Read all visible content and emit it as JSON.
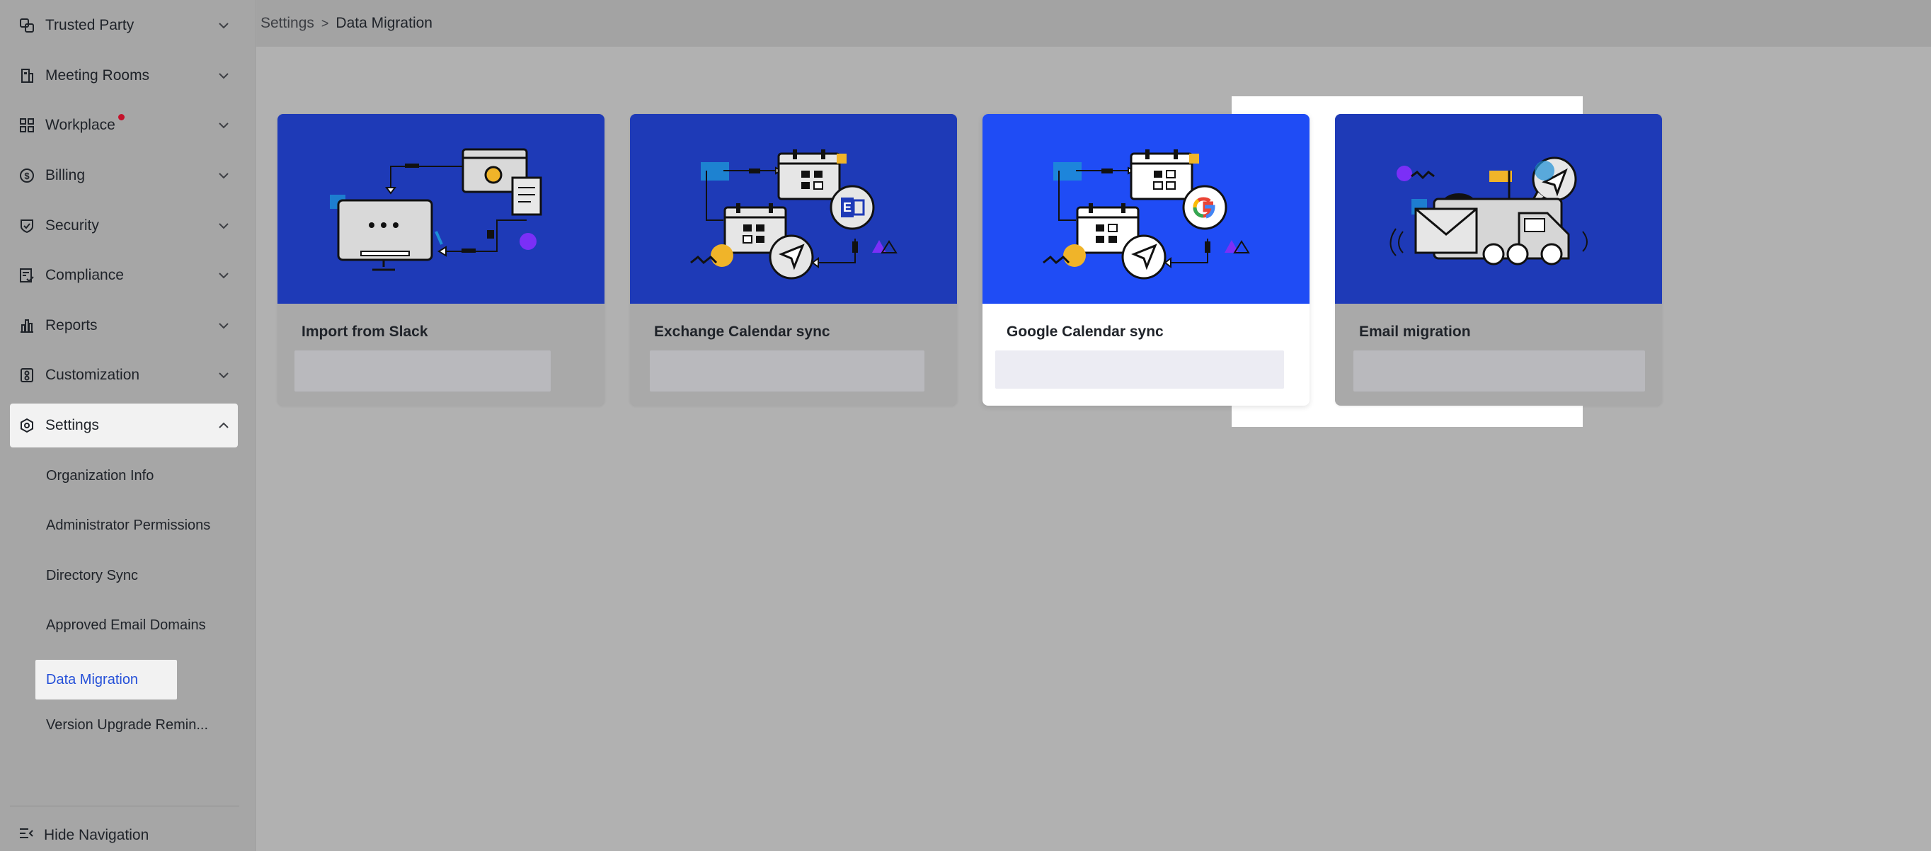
{
  "breadcrumb": {
    "parent": "Settings",
    "separator": ">",
    "current": "Data Migration"
  },
  "sidebar": {
    "items": [
      {
        "label": "Trusted Party",
        "icon": "link-frames-icon"
      },
      {
        "label": "Meeting Rooms",
        "icon": "building-icon"
      },
      {
        "label": "Workplace",
        "icon": "grid-icon",
        "badge": "red-dot"
      },
      {
        "label": "Billing",
        "icon": "dollar-circle-icon"
      },
      {
        "label": "Security",
        "icon": "shield-check-icon"
      },
      {
        "label": "Compliance",
        "icon": "document-check-icon"
      },
      {
        "label": "Reports",
        "icon": "bar-chart-icon"
      },
      {
        "label": "Customization",
        "icon": "sliders-icon"
      },
      {
        "label": "Settings",
        "icon": "gear-icon",
        "expanded": true
      }
    ],
    "settings_children": [
      "Organization Info",
      "Administrator Permissions",
      "Directory Sync",
      "Approved Email Domains",
      "Data Migration",
      "Version Upgrade Remin..."
    ],
    "active_child": "Data Migration",
    "hide_navigation": "Hide Navigation"
  },
  "cards": [
    {
      "title": "Import from Slack"
    },
    {
      "title": "Exchange Calendar sync"
    },
    {
      "title": "Google Calendar sync"
    },
    {
      "title": "Email migration"
    }
  ],
  "colors": {
    "card_banner": "#1e3ab7",
    "card_banner_focused": "#1f4cf5",
    "active_link": "#2550d8",
    "badge": "#c4122b"
  }
}
